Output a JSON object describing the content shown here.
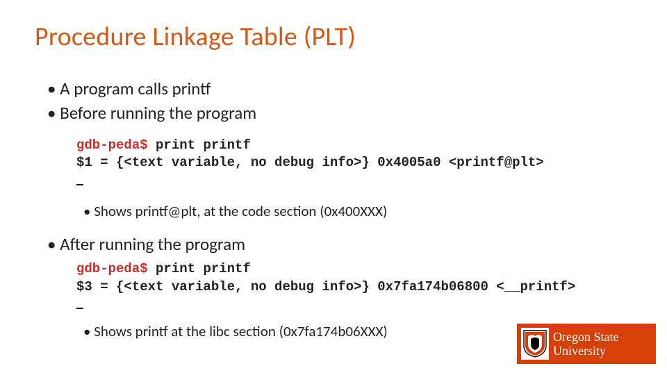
{
  "title": "Procedure Linkage Table (PLT)",
  "bullets": {
    "b1": "A program calls printf",
    "b2": "Before running the program",
    "b3": "Shows printf@plt, at the code section (0x400XXX)",
    "b4": "After running the program",
    "b5": "Shows printf at the libc section (0x7fa174b06XXX)"
  },
  "code1": {
    "prompt": "gdb-peda$",
    "cmd": " print printf",
    "out": "$1 = {<text variable, no debug info>} 0x4005a0 <printf@plt>"
  },
  "code2": {
    "prompt": "gdb-peda$",
    "cmd": " print printf",
    "out": "$3 = {<text variable, no debug info>} 0x7fa174b06800 <__printf>"
  },
  "logo": {
    "line1": "Oregon State",
    "line2": "University",
    "marksvg": "shield-icon"
  }
}
